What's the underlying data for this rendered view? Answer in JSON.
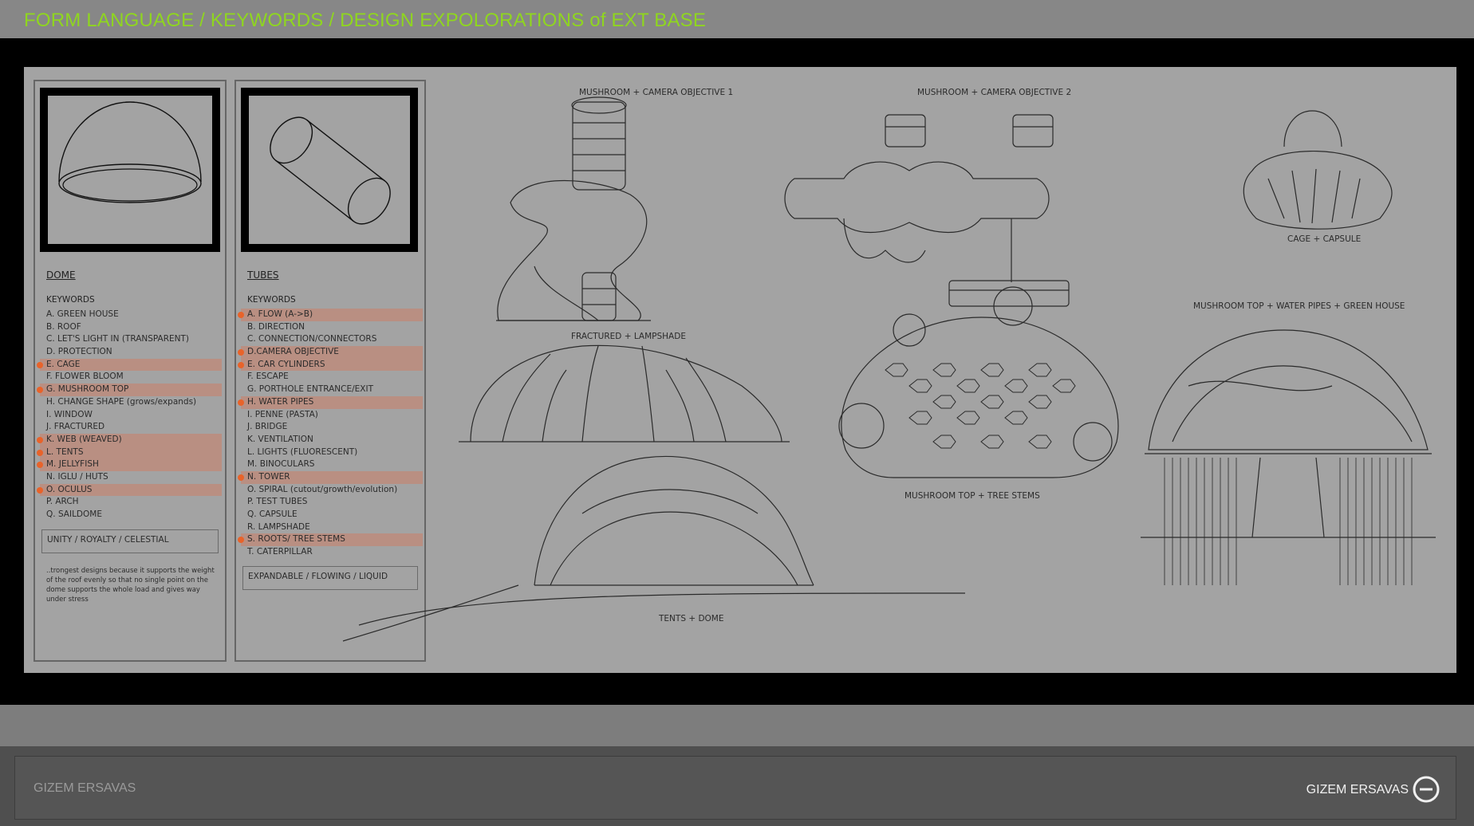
{
  "header": {
    "title": "FORM LANGUAGE / KEYWORDS / DESIGN EXPOLORATIONS of EXT BASE"
  },
  "dome_panel": {
    "heading": "DOME",
    "keywords_label": "KEYWORDS",
    "items": [
      {
        "label": "A. GREEN HOUSE",
        "highlighted": false
      },
      {
        "label": "B. ROOF",
        "highlighted": false
      },
      {
        "label": "C. LET'S LIGHT IN (TRANSPARENT)",
        "highlighted": false
      },
      {
        "label": "D. PROTECTION",
        "highlighted": false
      },
      {
        "label": "E. CAGE",
        "highlighted": true
      },
      {
        "label": "F. FLOWER BLOOM",
        "highlighted": false
      },
      {
        "label": "G. MUSHROOM TOP",
        "highlighted": true
      },
      {
        "label": "H. CHANGE SHAPE (grows/expands)",
        "highlighted": false
      },
      {
        "label": "I. WINDOW",
        "highlighted": false
      },
      {
        "label": "J. FRACTURED",
        "highlighted": false
      },
      {
        "label": "K. WEB (WEAVED)",
        "highlighted": true
      },
      {
        "label": "L. TENTS",
        "highlighted": true
      },
      {
        "label": "M. JELLYFISH",
        "highlighted": true
      },
      {
        "label": "N. IGLU / HUTS",
        "highlighted": false
      },
      {
        "label": "O. OCULUS",
        "highlighted": true
      },
      {
        "label": "P. ARCH",
        "highlighted": false
      },
      {
        "label": "Q. SAILDOME",
        "highlighted": false
      }
    ],
    "summary": "UNITY / ROYALTY / CELESTIAL",
    "note": "..trongest designs because it supports the weight of the roof evenly so that no single point on the dome supports the whole load and gives way under stress"
  },
  "tubes_panel": {
    "heading": "TUBES",
    "keywords_label": "KEYWORDS",
    "items": [
      {
        "label": "A. FLOW (A->B)",
        "highlighted": true
      },
      {
        "label": "B. DIRECTION",
        "highlighted": false
      },
      {
        "label": "C. CONNECTION/CONNECTORS",
        "highlighted": false
      },
      {
        "label": "D.CAMERA OBJECTIVE",
        "highlighted": true
      },
      {
        "label": "E. CAR CYLINDERS",
        "highlighted": true
      },
      {
        "label": "F. ESCAPE",
        "highlighted": false
      },
      {
        "label": "G. PORTHOLE ENTRANCE/EXIT",
        "highlighted": false
      },
      {
        "label": "H. WATER PIPES",
        "highlighted": true
      },
      {
        "label": "I. PENNE (PASTA)",
        "highlighted": false
      },
      {
        "label": "J. BRIDGE",
        "highlighted": false
      },
      {
        "label": "K. VENTILATION",
        "highlighted": false
      },
      {
        "label": "L. LIGHTS (FLUORESCENT)",
        "highlighted": false
      },
      {
        "label": "M. BINOCULARS",
        "highlighted": false
      },
      {
        "label": "N. TOWER",
        "highlighted": true
      },
      {
        "label": "O. SPIRAL (cutout/growth/evolution)",
        "highlighted": false
      },
      {
        "label": "P. TEST TUBES",
        "highlighted": false
      },
      {
        "label": "Q. CAPSULE",
        "highlighted": false
      },
      {
        "label": "R. LAMPSHADE",
        "highlighted": false
      },
      {
        "label": "S. ROOTS/ TREE STEMS",
        "highlighted": true
      },
      {
        "label": "T. CATERPILLAR",
        "highlighted": false
      }
    ],
    "summary": "EXPANDABLE / FLOWING / LIQUID"
  },
  "sketch_labels": {
    "mushroom_camera_1": "MUSHROOM + CAMERA OBJECTIVE 1",
    "mushroom_camera_2": "MUSHROOM + CAMERA OBJECTIVE 2",
    "cage_capsule": "CAGE + CAPSULE",
    "fractured_lampshade": "FRACTURED + LAMPSHADE",
    "mushroom_water_green": "MUSHROOM TOP + WATER PIPES + GREEN HOUSE",
    "mushroom_tree": "MUSHROOM TOP + TREE STEMS",
    "tents_dome": "TENTS + DOME"
  },
  "footer": {
    "author_left": "GIZEM ERSAVAS",
    "author_right": "GIZEM ERSAVAS"
  },
  "colors": {
    "title_green": "#8fd61f",
    "highlight_orange": "#e8632a",
    "highlight_band": "#b98f82"
  }
}
